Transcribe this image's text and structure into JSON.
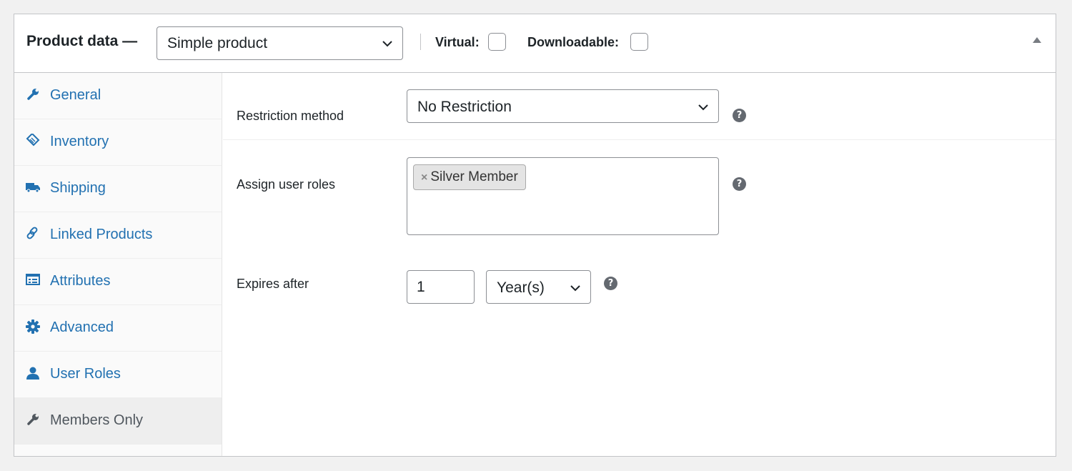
{
  "header": {
    "title": "Product data —",
    "product_type": "Simple product",
    "virtual_label": "Virtual:",
    "virtual_checked": false,
    "downloadable_label": "Downloadable:",
    "downloadable_checked": false
  },
  "sidebar": {
    "items": [
      {
        "label": "General",
        "icon": "wrench-icon"
      },
      {
        "label": "Inventory",
        "icon": "tag-icon"
      },
      {
        "label": "Shipping",
        "icon": "truck-icon"
      },
      {
        "label": "Linked Products",
        "icon": "link-icon"
      },
      {
        "label": "Attributes",
        "icon": "list-icon"
      },
      {
        "label": "Advanced",
        "icon": "gear-icon"
      },
      {
        "label": "User Roles",
        "icon": "user-icon"
      },
      {
        "label": "Members Only",
        "icon": "wrench-icon",
        "active": true
      }
    ]
  },
  "content": {
    "restriction": {
      "label": "Restriction method",
      "value": "No Restriction"
    },
    "roles": {
      "label": "Assign user roles",
      "selected": [
        "Silver Member"
      ],
      "remove_glyph": "×"
    },
    "expires": {
      "label": "Expires after",
      "value": "1",
      "unit": "Year(s)"
    },
    "help_glyph": "?"
  },
  "colors": {
    "link": "#2271b1",
    "active_tab_text": "#50575e",
    "help_icon": "#646970",
    "border": "#c3c4c7"
  }
}
